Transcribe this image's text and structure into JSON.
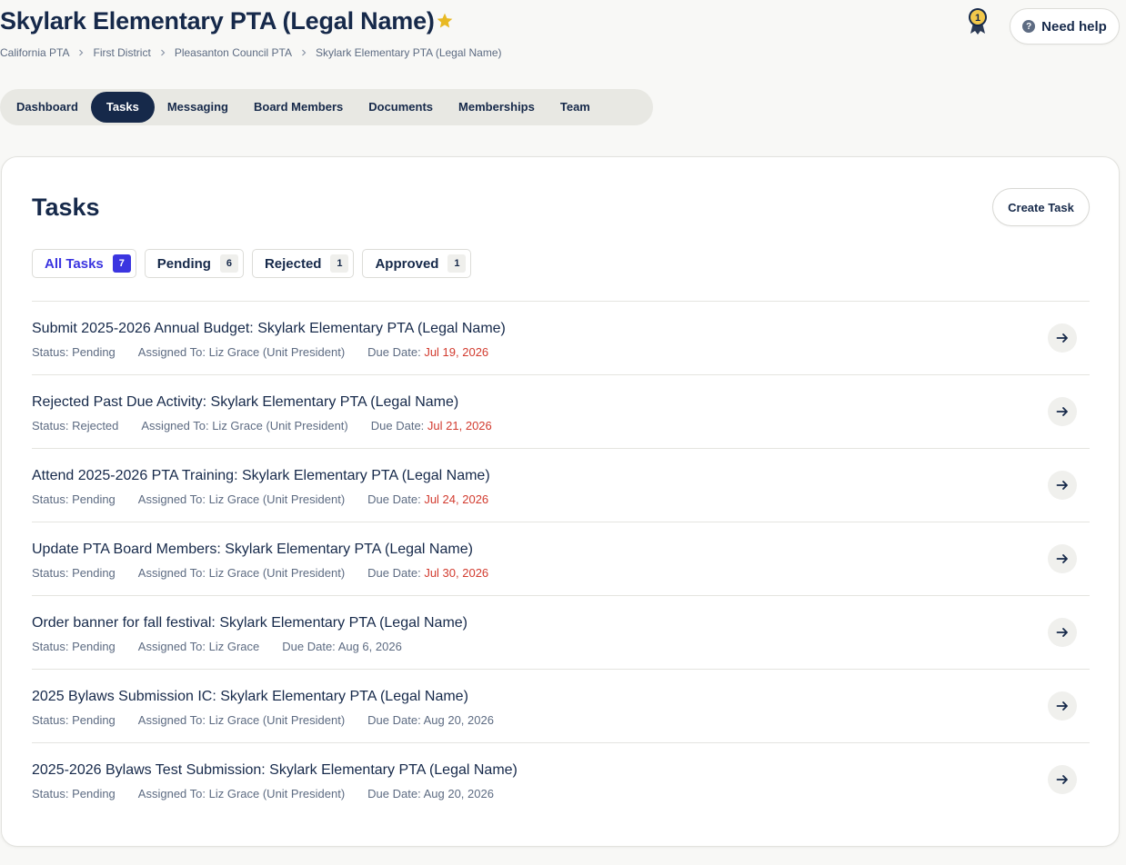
{
  "header": {
    "title": "Skylark Elementary PTA (Legal Name)",
    "breadcrumb": [
      "California PTA",
      "First District",
      "Pleasanton Council PTA",
      "Skylark Elementary PTA (Legal Name)"
    ],
    "award_count": "1",
    "help_label": "Need help",
    "help_icon_glyph": "?"
  },
  "nav": {
    "tabs": [
      "Dashboard",
      "Tasks",
      "Messaging",
      "Board Members",
      "Documents",
      "Memberships",
      "Team"
    ],
    "active": "Tasks"
  },
  "tasks_page": {
    "title": "Tasks",
    "create_label": "Create Task",
    "filters": [
      {
        "label": "All Tasks",
        "count": "7"
      },
      {
        "label": "Pending",
        "count": "6"
      },
      {
        "label": "Rejected",
        "count": "1"
      },
      {
        "label": "Approved",
        "count": "1"
      }
    ],
    "tasks": [
      {
        "title": "Submit 2025-2026 Annual Budget: Skylark Elementary PTA (Legal Name)",
        "status": "Status: Pending",
        "assigned": "Assigned To: Liz Grace (Unit President)",
        "due_label": "Due Date: ",
        "due": "Jul 19, 2026",
        "overdue": true
      },
      {
        "title": "Rejected Past Due Activity: Skylark Elementary PTA (Legal Name)",
        "status": "Status: Rejected",
        "assigned": "Assigned To: Liz Grace (Unit President)",
        "due_label": "Due Date: ",
        "due": "Jul 21, 2026",
        "overdue": true
      },
      {
        "title": "Attend 2025-2026 PTA Training: Skylark Elementary PTA (Legal Name)",
        "status": "Status: Pending",
        "assigned": "Assigned To: Liz Grace (Unit President)",
        "due_label": "Due Date: ",
        "due": "Jul 24, 2026",
        "overdue": true
      },
      {
        "title": "Update PTA Board Members: Skylark Elementary PTA (Legal Name)",
        "status": "Status: Pending",
        "assigned": "Assigned To: Liz Grace (Unit President)",
        "due_label": "Due Date: ",
        "due": "Jul 30, 2026",
        "overdue": true
      },
      {
        "title": "Order banner for fall festival: Skylark Elementary PTA (Legal Name)",
        "status": "Status: Pending",
        "assigned": "Assigned To: Liz Grace",
        "due_label": "Due Date: ",
        "due": "Aug 6, 2026",
        "overdue": false
      },
      {
        "title": "2025 Bylaws Submission IC: Skylark Elementary PTA (Legal Name)",
        "status": "Status: Pending",
        "assigned": "Assigned To: Liz Grace (Unit President)",
        "due_label": "Due Date: ",
        "due": "Aug 20, 2026",
        "overdue": false
      },
      {
        "title": "2025-2026 Bylaws Test Submission: Skylark Elementary PTA (Legal Name)",
        "status": "Status: Pending",
        "assigned": "Assigned To: Liz Grace (Unit President)",
        "due_label": "Due Date: ",
        "due": "Aug 20, 2026",
        "overdue": false
      }
    ]
  },
  "colors": {
    "navy": "#16294a",
    "accent": "#3b35e0",
    "overdue": "#d23b2f",
    "star": "#e8b923"
  }
}
